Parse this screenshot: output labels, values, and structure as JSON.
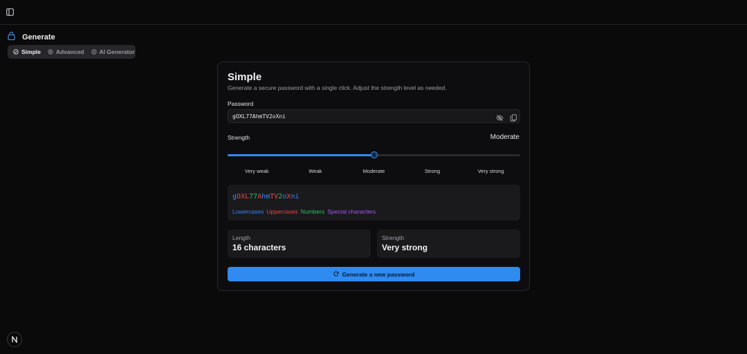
{
  "header": {
    "title": "Generate"
  },
  "tabs": [
    {
      "label": "Simple",
      "active": true,
      "icon": "check-circle-icon"
    },
    {
      "label": "Advanced",
      "active": false,
      "icon": "gear-icon"
    },
    {
      "label": "AI Generator",
      "active": false,
      "icon": "openai-icon"
    }
  ],
  "card": {
    "title": "Simple",
    "description": "Generate a secure password with a single click. Adjust the strength level as needed.",
    "password_label": "Password",
    "password_value": "gOXL77AhmTV2oXni",
    "strength_label": "Strength",
    "strength_value": "Moderate",
    "strength_level": 0.5,
    "strength_levels": [
      "Very weak",
      "Weak",
      "Moderate",
      "Strong",
      "Very strong"
    ],
    "preview_chars": [
      {
        "c": "g",
        "t": "lower"
      },
      {
        "c": "O",
        "t": "upper"
      },
      {
        "c": "X",
        "t": "upper"
      },
      {
        "c": "L",
        "t": "upper"
      },
      {
        "c": "7",
        "t": "number"
      },
      {
        "c": "7",
        "t": "number"
      },
      {
        "c": "A",
        "t": "upper"
      },
      {
        "c": "h",
        "t": "lower"
      },
      {
        "c": "m",
        "t": "lower"
      },
      {
        "c": "T",
        "t": "upper"
      },
      {
        "c": "V",
        "t": "upper"
      },
      {
        "c": "2",
        "t": "number"
      },
      {
        "c": "o",
        "t": "lower"
      },
      {
        "c": "X",
        "t": "upper"
      },
      {
        "c": "n",
        "t": "lower"
      },
      {
        "c": "i",
        "t": "lower"
      }
    ],
    "legend": {
      "lowercases": "Lowercases",
      "uppercases": "Uppercases",
      "numbers": "Numbers",
      "special": "Special characters"
    },
    "length_label": "Length",
    "length_value": "16 characters",
    "overall_strength_label": "Strength",
    "overall_strength_value": "Very strong",
    "generate_button": "Generate a new password"
  },
  "colors": {
    "accent": "#2f8bf0",
    "lower": "#3b82f6",
    "upper": "#ef4444",
    "number": "#22c55e",
    "special": "#a855f7"
  },
  "icons": {
    "sidebar_toggle": "sidebar-toggle-icon",
    "generate": "lock-icon",
    "visibility": "eye-off-icon",
    "copy": "copy-icon",
    "refresh": "refresh-icon",
    "logo": "n-logo-icon"
  }
}
